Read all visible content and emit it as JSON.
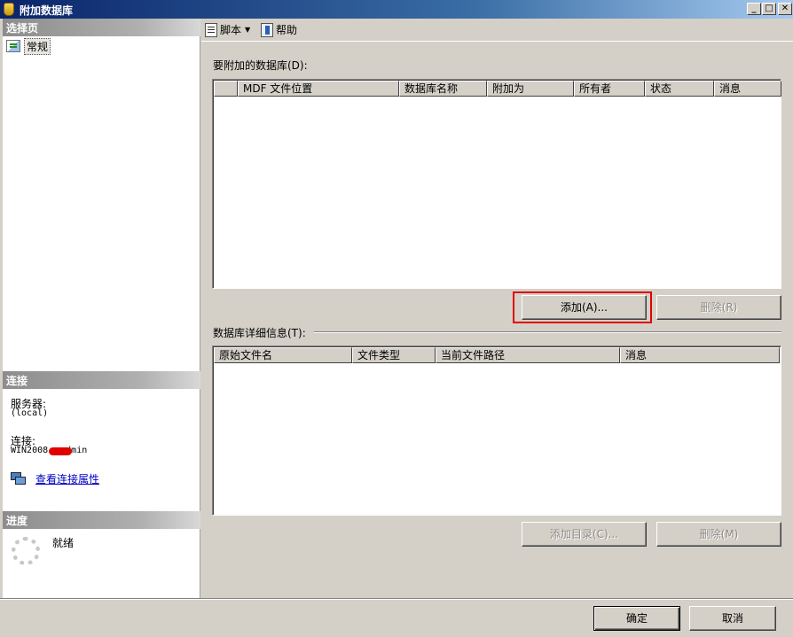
{
  "window": {
    "title": "附加数据库",
    "minimize": "_",
    "maximize": "□",
    "close": "✕"
  },
  "left_panel": {
    "select_page_header": "选择页",
    "pages": [
      {
        "label": "常规"
      }
    ],
    "connection_header": "连接",
    "server_label": "服务器:",
    "server_value": "(local)",
    "connection_label": "连接:",
    "connection_value_prefix": "WIN2008",
    "connection_value_suffix": "dmin",
    "view_connection_link": "查看连接属性",
    "progress_header": "进度",
    "progress_status": "就绪"
  },
  "toolbar": {
    "script_label": "脚本",
    "help_label": "帮助"
  },
  "attach_section": {
    "label": "要附加的数据库(D):",
    "columns": [
      "",
      "MDF 文件位置",
      "数据库名称",
      "附加为",
      "所有者",
      "状态",
      "消息"
    ],
    "add_button": "添加(A)...",
    "remove_button": "删除(R)"
  },
  "details_section": {
    "label": "数据库详细信息(T):",
    "columns": [
      "原始文件名",
      "文件类型",
      "当前文件路径",
      "消息"
    ],
    "add_catalog_button": "添加目录(C)...",
    "remove_button": "删除(M)"
  },
  "footer": {
    "ok_button": "确定",
    "cancel_button": "取消"
  }
}
